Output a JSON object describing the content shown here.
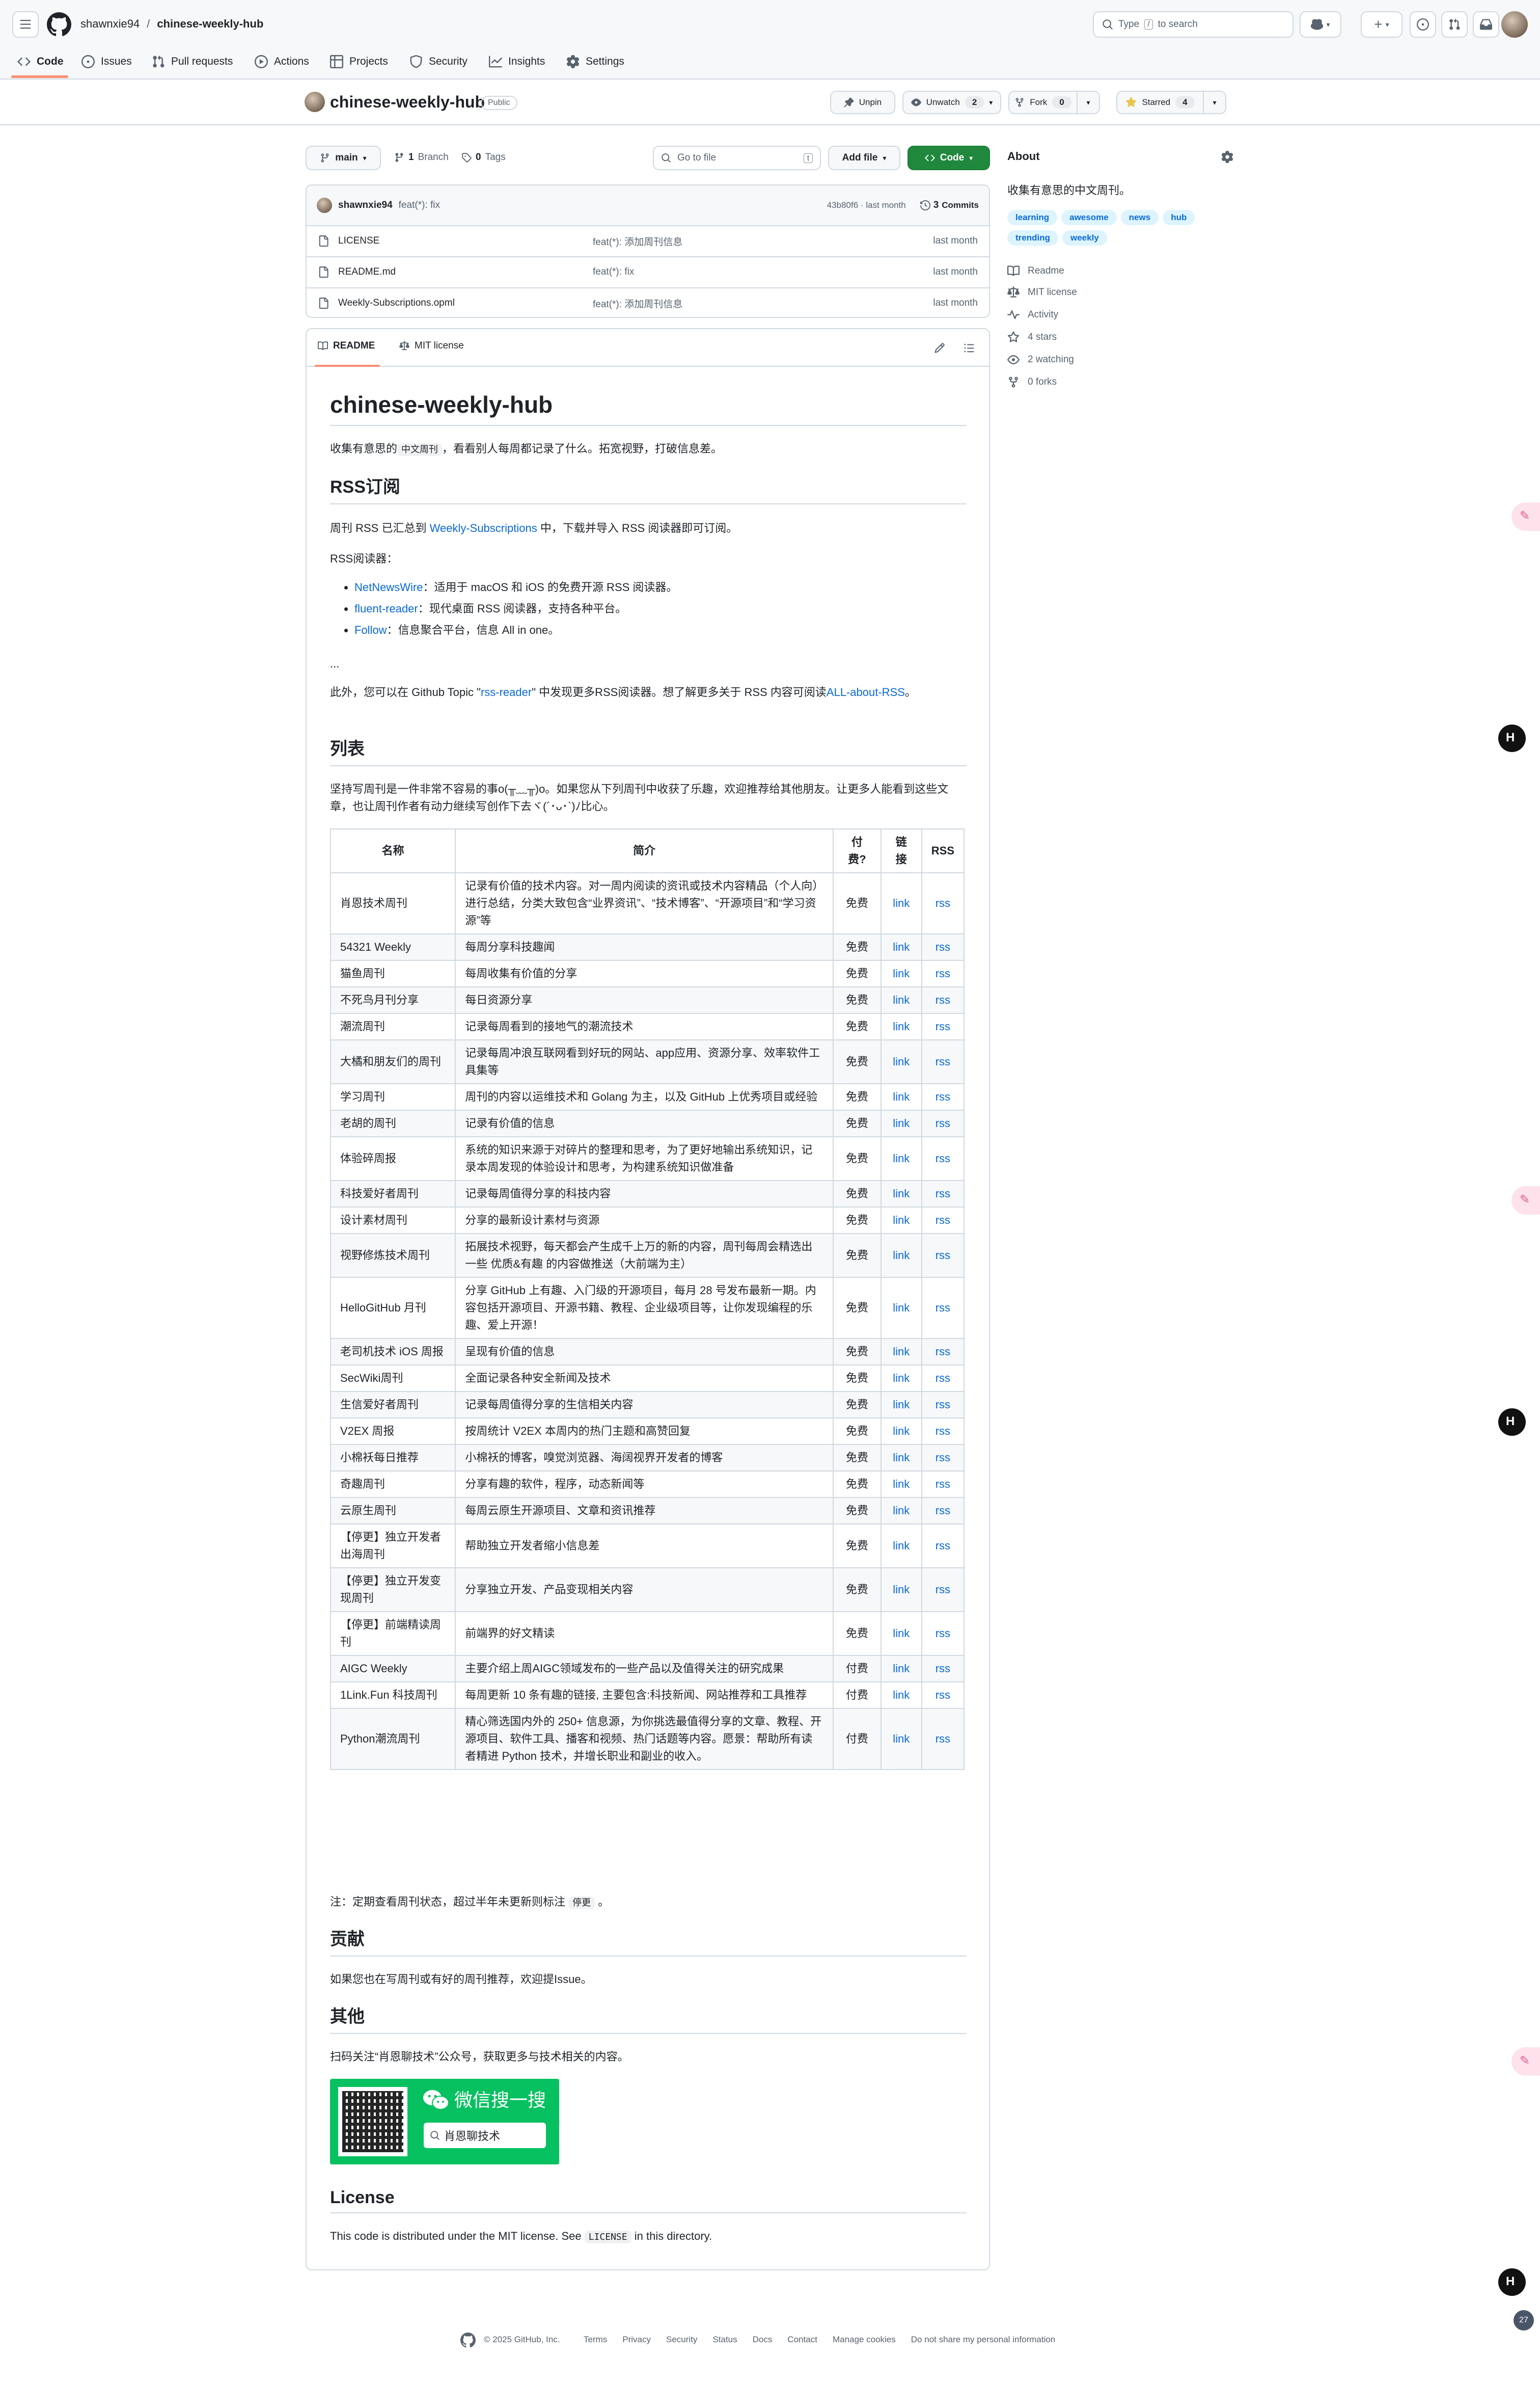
{
  "header": {
    "owner": "shawnxie94",
    "separator": "/",
    "repo": "chinese-weekly-hub",
    "search_prefix": "Type",
    "search_key": "/",
    "search_suffix": "to search",
    "plus": "+"
  },
  "nav": {
    "tabs": [
      {
        "label": "Code",
        "active": true
      },
      {
        "label": "Issues"
      },
      {
        "label": "Pull requests"
      },
      {
        "label": "Actions"
      },
      {
        "label": "Projects"
      },
      {
        "label": "Security"
      },
      {
        "label": "Insights"
      },
      {
        "label": "Settings"
      }
    ]
  },
  "repo": {
    "name": "chinese-weekly-hub",
    "visibility": "Public",
    "unpin": "Unpin",
    "unwatch": "Unwatch",
    "watch_count": "2",
    "fork": "Fork",
    "fork_count": "0",
    "starred": "Starred",
    "star_count": "4"
  },
  "toolbar": {
    "branch": "main",
    "branches_count": "1",
    "branches_label": "Branch",
    "tags_count": "0",
    "tags_label": "Tags",
    "goto_placeholder": "Go to file",
    "goto_key": "t",
    "add_file": "Add file",
    "code": "Code"
  },
  "commit": {
    "author": "shawnxie94",
    "message": "feat(*): fix",
    "hash": "43b80f6 · last month",
    "commits_count": "3",
    "commits_label": "Commits"
  },
  "files": [
    {
      "name": "LICENSE",
      "message": "feat(*): 添加周刊信息",
      "time": "last month"
    },
    {
      "name": "README.md",
      "message": "feat(*): fix",
      "time": "last month"
    },
    {
      "name": "Weekly-Subscriptions.opml",
      "message": "feat(*): 添加周刊信息",
      "time": "last month"
    }
  ],
  "readme_tabs": {
    "readme": "README",
    "license": "MIT license"
  },
  "about": {
    "title": "About",
    "description": "收集有意思的中文周刊。",
    "topics": [
      "learning",
      "awesome",
      "news",
      "hub",
      "trending",
      "weekly"
    ],
    "links": [
      {
        "icon": "book-icon",
        "label": "Readme"
      },
      {
        "icon": "law-icon",
        "label": "MIT license"
      },
      {
        "icon": "pulse-icon",
        "label": "Activity"
      },
      {
        "icon": "star-icon",
        "label": "4 stars"
      },
      {
        "icon": "eye-icon",
        "label": "2 watching"
      },
      {
        "icon": "fork-icon",
        "label": "0 forks"
      }
    ]
  },
  "readme": {
    "h1": "chinese-weekly-hub",
    "intro_before": "收集有意思的",
    "intro_code": "中文周刊",
    "intro_after": "，看看别人每周都记录了什么。拓宽视野，打破信息差。",
    "rss_h2": "RSS订阅",
    "rss_p_before": "周刊 RSS 已汇总到",
    "rss_p_link": "Weekly-Subscriptions",
    "rss_p_after": "中，下载并导入 RSS 阅读器即可订阅。",
    "reader_title": "RSS阅读器：",
    "readers": [
      {
        "name": "NetNewsWire",
        "desc": "：适用于 macOS 和 iOS 的免费开源 RSS 阅读器。"
      },
      {
        "name": "fluent-reader",
        "desc": "：现代桌面 RSS 阅读器，支持各种平台。"
      },
      {
        "name": "Follow",
        "desc": "：信息聚合平台，信息 All in one。"
      }
    ],
    "ellipsis": "...",
    "more_before": "此外，您可以在 Github Topic \"",
    "more_link1": "rss-reader",
    "more_mid": "\" 中发现更多RSS阅读器。想了解更多关于 RSS 内容可阅读",
    "more_link2": "ALL-about-RSS",
    "more_end": "。",
    "list_h2": "列表",
    "list_p": "坚持写周刊是一件非常不容易的事o(╥﹏╥)o。如果您从下列周刊中收获了乐趣，欢迎推荐给其他朋友。让更多人能看到这些文章，也让周刊作者有动力继续写创作下去ヾ(´･ᴗ･`)ﾉ比心。",
    "table_headers": [
      "名称",
      "简介",
      "付费?",
      "链接",
      "RSS"
    ],
    "table_rows": [
      {
        "name": "肖恩技术周刊",
        "desc": "记录有价值的技术内容。对一周内阅读的资讯或技术内容精品（个人向）进行总结，分类大致包含“业界资讯”、“技术博客”、“开源项目”和“学习资源”等",
        "fee": "免费",
        "link": "link",
        "rss": "rss"
      },
      {
        "name": "54321 Weekly",
        "desc": "每周分享科技趣闻",
        "fee": "免费",
        "link": "link",
        "rss": "rss"
      },
      {
        "name": "猫鱼周刊",
        "desc": "每周收集有价值的分享",
        "fee": "免费",
        "link": "link",
        "rss": "rss"
      },
      {
        "name": "不死鸟月刊分享",
        "desc": "每日资源分享",
        "fee": "免费",
        "link": "link",
        "rss": "rss"
      },
      {
        "name": "潮流周刊",
        "desc": "记录每周看到的接地气的潮流技术",
        "fee": "免费",
        "link": "link",
        "rss": "rss"
      },
      {
        "name": "大橘和朋友们的周刊",
        "desc": "记录每周冲浪互联网看到好玩的网站、app应用、资源分享、效率软件工具集等",
        "fee": "免费",
        "link": "link",
        "rss": "rss"
      },
      {
        "name": "学习周刊",
        "desc": "周刊的内容以运维技术和 Golang 为主，以及 GitHub 上优秀项目或经验",
        "fee": "免费",
        "link": "link",
        "rss": "rss"
      },
      {
        "name": "老胡的周刊",
        "desc": "记录有价值的信息",
        "fee": "免费",
        "link": "link",
        "rss": "rss"
      },
      {
        "name": "体验碎周报",
        "desc": "系统的知识来源于对碎片的整理和思考，为了更好地输出系统知识，记录本周发现的体验设计和思考，为构建系统知识做准备",
        "fee": "免费",
        "link": "link",
        "rss": "rss"
      },
      {
        "name": "科技爱好者周刊",
        "desc": "记录每周值得分享的科技内容",
        "fee": "免费",
        "link": "link",
        "rss": "rss"
      },
      {
        "name": "设计素材周刊",
        "desc": "分享的最新设计素材与资源",
        "fee": "免费",
        "link": "link",
        "rss": "rss"
      },
      {
        "name": "视野修炼技术周刊",
        "desc": "拓展技术视野，每天都会产生成千上万的新的内容，周刊每周会精选出一些 优质&有趣 的内容做推送（大前端为主）",
        "fee": "免费",
        "link": "link",
        "rss": "rss"
      },
      {
        "name": "HelloGitHub 月刊",
        "desc": "分享 GitHub 上有趣、入门级的开源项目，每月 28 号发布最新一期。内容包括开源项目、开源书籍、教程、企业级项目等，让你发现编程的乐趣、爱上开源！",
        "fee": "免费",
        "link": "link",
        "rss": "rss"
      },
      {
        "name": "老司机技术 iOS 周报",
        "desc": "呈现有价值的信息",
        "fee": "免费",
        "link": "link",
        "rss": "rss"
      },
      {
        "name": "SecWiki周刊",
        "desc": "全面记录各种安全新闻及技术",
        "fee": "免费",
        "link": "link",
        "rss": "rss"
      },
      {
        "name": "生信爱好者周刊",
        "desc": "记录每周值得分享的生信相关内容",
        "fee": "免费",
        "link": "link",
        "rss": "rss"
      },
      {
        "name": "V2EX 周报",
        "desc": "按周统计 V2EX 本周内的热门主题和高赞回复",
        "fee": "免费",
        "link": "link",
        "rss": "rss"
      },
      {
        "name": "小棉袄每日推荐",
        "desc": "小棉袄的博客，嗅觉浏览器、海阔视界开发者的博客",
        "fee": "免费",
        "link": "link",
        "rss": "rss"
      },
      {
        "name": "奇趣周刊",
        "desc": "分享有趣的软件，程序，动态新闻等",
        "fee": "免费",
        "link": "link",
        "rss": "rss"
      },
      {
        "name": "云原生周刊",
        "desc": "每周云原生开源项目、文章和资讯推荐",
        "fee": "免费",
        "link": "link",
        "rss": "rss"
      },
      {
        "name": "【停更】独立开发者出海周刊",
        "desc": "帮助独立开发者缩小信息差",
        "fee": "免费",
        "link": "link",
        "rss": "rss"
      },
      {
        "name": "【停更】独立开发变现周刊",
        "desc": "分享独立开发、产品变现相关内容",
        "fee": "免费",
        "link": "link",
        "rss": "rss"
      },
      {
        "name": "【停更】前端精读周刊",
        "desc": "前端界的好文精读",
        "fee": "免费",
        "link": "link",
        "rss": "rss"
      },
      {
        "name": "AIGC Weekly",
        "desc": "主要介绍上周AIGC领域发布的一些产品以及值得关注的研究成果",
        "fee": "付费",
        "link": "link",
        "rss": "rss"
      },
      {
        "name": "1Link.Fun 科技周刊",
        "desc": "每周更新 10 条有趣的链接, 主要包含:科技新闻、网站推荐和工具推荐",
        "fee": "付费",
        "link": "link",
        "rss": "rss"
      },
      {
        "name": "Python潮流周刊",
        "desc": "精心筛选国内外的 250+ 信息源，为你挑选最值得分享的文章、教程、开源项目、软件工具、播客和视频、热门话题等内容。愿景：帮助所有读者精进 Python 技术，并增长职业和副业的收入。",
        "fee": "付费",
        "link": "link",
        "rss": "rss"
      }
    ],
    "note_before": "注：定期查看周刊状态，超过半年未更新则标注",
    "note_code": "停更",
    "note_after": "。",
    "contrib_h2": "贡献",
    "contrib_p": "如果您也在写周刊或有好的周刊推荐，欢迎提Issue。",
    "other_h2": "其他",
    "other_p": "扫码关注“肖恩聊技术”公众号，获取更多与技术相关的内容。",
    "wechat_title": "微信搜一搜",
    "wechat_search": "肖恩聊技术",
    "license_h3": "License",
    "license_before": "This code is distributed under the MIT license. See",
    "license_code": "LICENSE",
    "license_after": "in this directory."
  },
  "footer": {
    "copyright": "© 2025 GitHub, Inc.",
    "links": [
      "Terms",
      "Privacy",
      "Security",
      "Status",
      "Docs",
      "Contact",
      "Manage cookies",
      "Do not share my personal information"
    ]
  },
  "floating": {
    "counter": "27"
  }
}
